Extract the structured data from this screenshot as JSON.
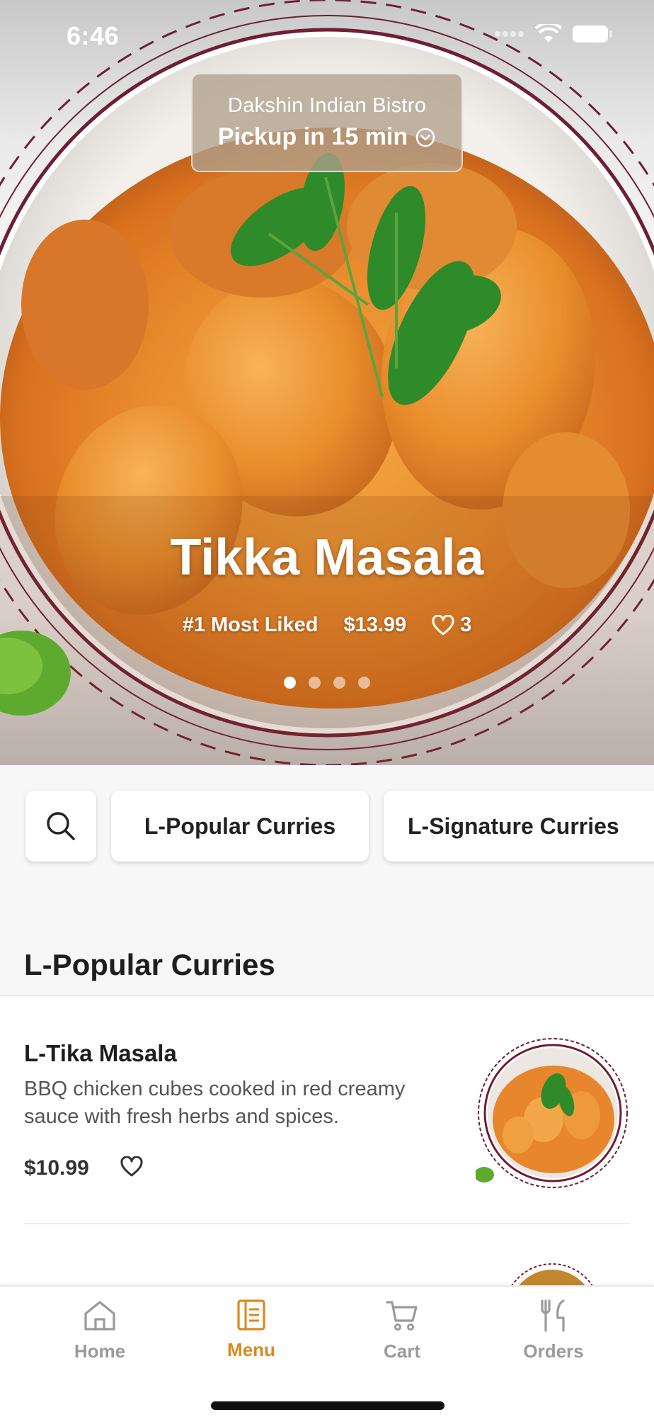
{
  "status_bar": {
    "time": "6:46"
  },
  "hero": {
    "store_name": "Dakshin Indian Bistro",
    "pickup_text": "Pickup in 15 min",
    "dish_title": "Tikka Masala",
    "tag": "#1 Most Liked",
    "price": "$13.99",
    "likes": "3",
    "carousel": {
      "count": 4,
      "active_index": 0
    }
  },
  "categories": {
    "chips": [
      {
        "label": "L-Popular Curries"
      },
      {
        "label": "L-Signature Curries"
      }
    ]
  },
  "section": {
    "title": "L-Popular Curries"
  },
  "items": [
    {
      "name": "L-Tika Masala",
      "description": "BBQ chicken cubes cooked in red creamy sauce with fresh herbs and spices.",
      "price": "$10.99"
    }
  ],
  "tab_bar": {
    "tabs": [
      {
        "label": "Home",
        "icon": "home-icon"
      },
      {
        "label": "Menu",
        "icon": "menu-icon"
      },
      {
        "label": "Cart",
        "icon": "cart-icon"
      },
      {
        "label": "Orders",
        "icon": "orders-icon"
      }
    ],
    "active": "Menu"
  },
  "colors": {
    "accent": "#d98a1f",
    "inactive": "#9a9a9a",
    "plate_border": "#6e1f33",
    "curry": "#e08a2c"
  }
}
